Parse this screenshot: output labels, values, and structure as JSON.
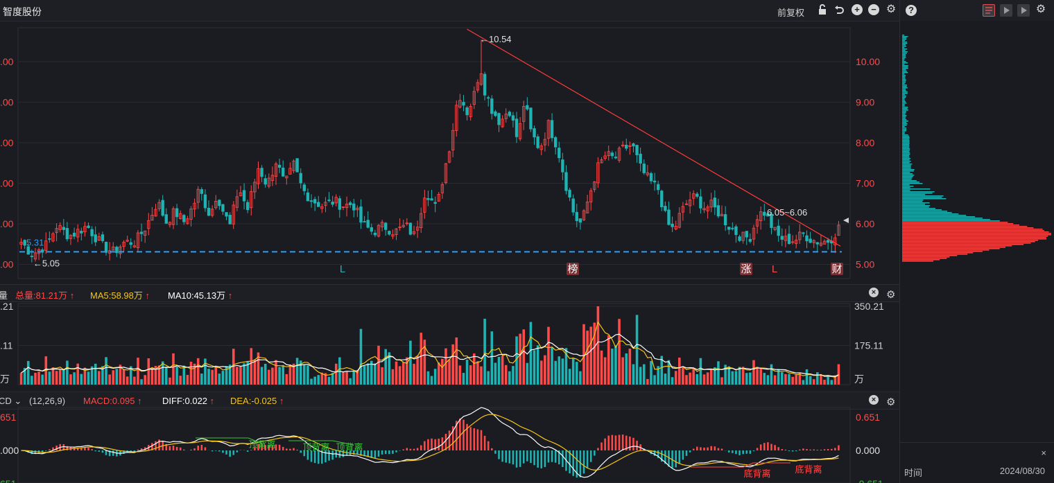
{
  "header": {
    "stock_name": "智度股份",
    "fuquan_label": "前复权"
  },
  "volume_bar": {
    "indicator_label": "量",
    "total": "总量:81.21万",
    "ma5": "MA5:58.98万",
    "ma10": "MA10:45.13万"
  },
  "macd_bar": {
    "indicator_label": "CD",
    "params": "(12,26,9)",
    "macd": "MACD:0.095",
    "diff": "DIFF:0.022",
    "dea": "DEA:-0.025"
  },
  "right_panel": {
    "time_label": "时间",
    "date_value": "2024/08/30",
    "close_label": "×"
  },
  "colors": {
    "up": "#ff4a4a",
    "down": "#1fb3b3",
    "ma5": "#f5c518",
    "ma10": "#ffffff",
    "support_line": "#2a9df4",
    "trend_line": "#ff3b3b",
    "signal_green": "#3ec43e"
  },
  "chart_data": [
    {
      "type": "candlestick",
      "id": "price",
      "ylim": [
        4.65,
        10.8
      ],
      "yticks_right": [
        "10.00",
        "9.00",
        "8.00",
        "7.00",
        "6.00",
        "5.00"
      ],
      "yticks_left": [
        ".00",
        ".00",
        ".00",
        ".00",
        ".00",
        ".00"
      ],
      "ytick_values": [
        10,
        9,
        8,
        7,
        6,
        5
      ],
      "num_bars": 232,
      "anchors": [
        [
          0,
          5.55
        ],
        [
          5,
          5.25
        ],
        [
          12,
          5.5
        ],
        [
          16,
          5.95
        ],
        [
          22,
          5.7
        ],
        [
          30,
          5.95
        ],
        [
          37,
          5.45
        ],
        [
          42,
          5.3
        ],
        [
          47,
          5.55
        ],
        [
          52,
          5.55
        ],
        [
          57,
          5.95
        ],
        [
          62,
          6.55
        ],
        [
          66,
          6.05
        ],
        [
          70,
          6.3
        ],
        [
          74,
          6.05
        ],
        [
          78,
          6.4
        ],
        [
          81,
          6.85
        ],
        [
          86,
          6.2
        ],
        [
          89,
          6.75
        ],
        [
          92,
          6.3
        ],
        [
          95,
          5.95
        ],
        [
          99,
          6.9
        ],
        [
          103,
          6.35
        ],
        [
          108,
          7.4
        ],
        [
          112,
          6.95
        ],
        [
          116,
          7.55
        ],
        [
          120,
          6.95
        ],
        [
          124,
          7.45
        ],
        [
          128,
          6.85
        ],
        [
          132,
          6.6
        ],
        [
          137,
          6.45
        ],
        [
          142,
          6.55
        ],
        [
          147,
          6.45
        ],
        [
          151,
          6.5
        ],
        [
          155,
          6.0
        ],
        [
          160,
          5.8
        ],
        [
          165,
          5.95
        ],
        [
          170,
          5.8
        ],
        [
          175,
          5.95
        ],
        [
          179,
          5.7
        ],
        [
          184,
          6.85
        ],
        [
          189,
          6.35
        ],
        [
          191,
          6.9
        ],
        [
          196,
          8.2
        ],
        [
          199,
          9.25
        ],
        [
          203,
          8.75
        ],
        [
          206,
          9.15
        ],
        [
          209,
          9.9
        ],
        [
          211,
          9.3
        ],
        [
          214,
          8.85
        ],
        [
          218,
          8.5
        ],
        [
          222,
          8.85
        ],
        [
          226,
          8.05
        ],
        [
          229,
          9.05
        ],
        [
          232,
          8.25
        ],
        [
          236,
          7.85
        ],
        [
          240,
          8.45
        ],
        [
          244,
          7.9
        ],
        [
          248,
          6.95
        ],
        [
          252,
          6.15
        ],
        [
          255,
          6.0
        ],
        [
          258,
          6.6
        ],
        [
          262,
          7.35
        ],
        [
          266,
          7.7
        ],
        [
          270,
          7.6
        ],
        [
          274,
          7.85
        ],
        [
          278,
          7.95
        ],
        [
          282,
          7.35
        ],
        [
          286,
          7.05
        ],
        [
          290,
          6.85
        ],
        [
          294,
          6.0
        ],
        [
          297,
          5.85
        ],
        [
          300,
          6.25
        ],
        [
          304,
          6.6
        ],
        [
          307,
          6.65
        ],
        [
          311,
          6.4
        ],
        [
          314,
          6.45
        ],
        [
          318,
          6.25
        ],
        [
          322,
          5.95
        ],
        [
          326,
          5.75
        ],
        [
          329,
          5.65
        ],
        [
          332,
          5.7
        ],
        [
          335,
          6.2
        ],
        [
          338,
          6.3
        ],
        [
          341,
          6.0
        ],
        [
          344,
          5.7
        ],
        [
          348,
          5.6
        ],
        [
          352,
          5.6
        ],
        [
          356,
          5.75
        ],
        [
          360,
          5.6
        ],
        [
          364,
          5.55
        ],
        [
          368,
          5.6
        ],
        [
          372,
          5.9
        ]
      ],
      "high": 10.54,
      "low": 5.05,
      "support_level": 5.31,
      "annotations": [
        {
          "text": "←10.54",
          "type": "high"
        },
        {
          "text": "←5.05",
          "type": "low"
        },
        {
          "text": "5.31",
          "type": "support"
        },
        {
          "text": "6.05~6.06",
          "type": "price_range"
        }
      ],
      "event_markers": [
        {
          "text": "L",
          "color": "#1fb3b3"
        },
        {
          "text": "榜",
          "color": "#ffffff",
          "boxed": true
        },
        {
          "text": "涨",
          "color": "#ffffff",
          "boxed": true
        },
        {
          "text": "L",
          "color": "#ff4a4a"
        },
        {
          "text": "财",
          "color": "#ffffff",
          "boxed": true
        }
      ]
    },
    {
      "type": "bar",
      "id": "volume",
      "ylim": [
        0,
        350.21
      ],
      "yticks_right": [
        "350.21",
        "175.11",
        "万"
      ],
      "yticks_left": [
        ".21",
        ".11",
        "万"
      ],
      "ytick_values": [
        350.21,
        175.11,
        0
      ],
      "series": [
        {
          "name": "MA5"
        },
        {
          "name": "MA10"
        }
      ]
    },
    {
      "type": "bar",
      "id": "macd",
      "ylim": [
        -0.651,
        0.651
      ],
      "yticks_right": [
        "0.651",
        "0.000",
        "-0.651"
      ],
      "yticks_left": [
        "651",
        ".000",
        "651"
      ],
      "ytick_values": [
        0.651,
        0,
        -0.651
      ],
      "series": [
        {
          "name": "DIFF"
        },
        {
          "name": "DEA"
        }
      ],
      "annotations": [
        {
          "text": "顶背离",
          "color": "#3ec43e"
        },
        {
          "text": "顶背离",
          "color": "#3ec43e"
        },
        {
          "text": "顶背离",
          "color": "#3ec43e"
        },
        {
          "text": "底背离",
          "color": "#ff4a4a"
        },
        {
          "text": "底背离",
          "color": "#ff4a4a"
        }
      ]
    }
  ]
}
